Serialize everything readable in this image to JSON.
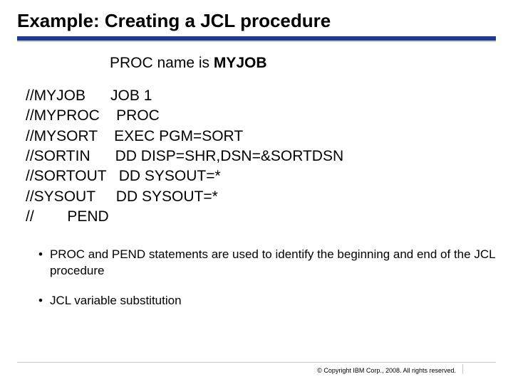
{
  "title": "Example: Creating a JCL procedure",
  "subtitle": {
    "prefix": "PROC name is ",
    "name": "MYJOB"
  },
  "jcl_lines": [
    "//MYJOB      JOB 1",
    "//MYPROC    PROC",
    "//MYSORT    EXEC PGM=SORT",
    "//SORTIN      DD DISP=SHR,DSN=&SORTDSN",
    "//SORTOUT   DD SYSOUT=*",
    "//SYSOUT     DD SYSOUT=*",
    "//        PEND"
  ],
  "bullets": [
    "PROC and PEND statements are used to identify the beginning and end of the JCL procedure",
    "JCL variable substitution"
  ],
  "copyright": "© Copyright IBM Corp., 2008. All rights reserved."
}
